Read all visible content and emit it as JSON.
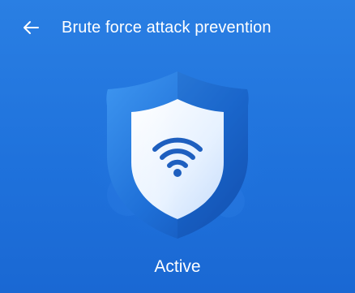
{
  "header": {
    "back_icon": "arrow-left-icon",
    "title": "Brute force attack prevention"
  },
  "hero": {
    "icon": "wifi-shield-icon"
  },
  "status": {
    "label": "Active"
  },
  "colors": {
    "background": "#2176df",
    "shield_outer": "#1a5fc4",
    "shield_inner": "#e9f3ff",
    "wifi_symbol": "#1e5fbf",
    "text": "#ffffff"
  }
}
